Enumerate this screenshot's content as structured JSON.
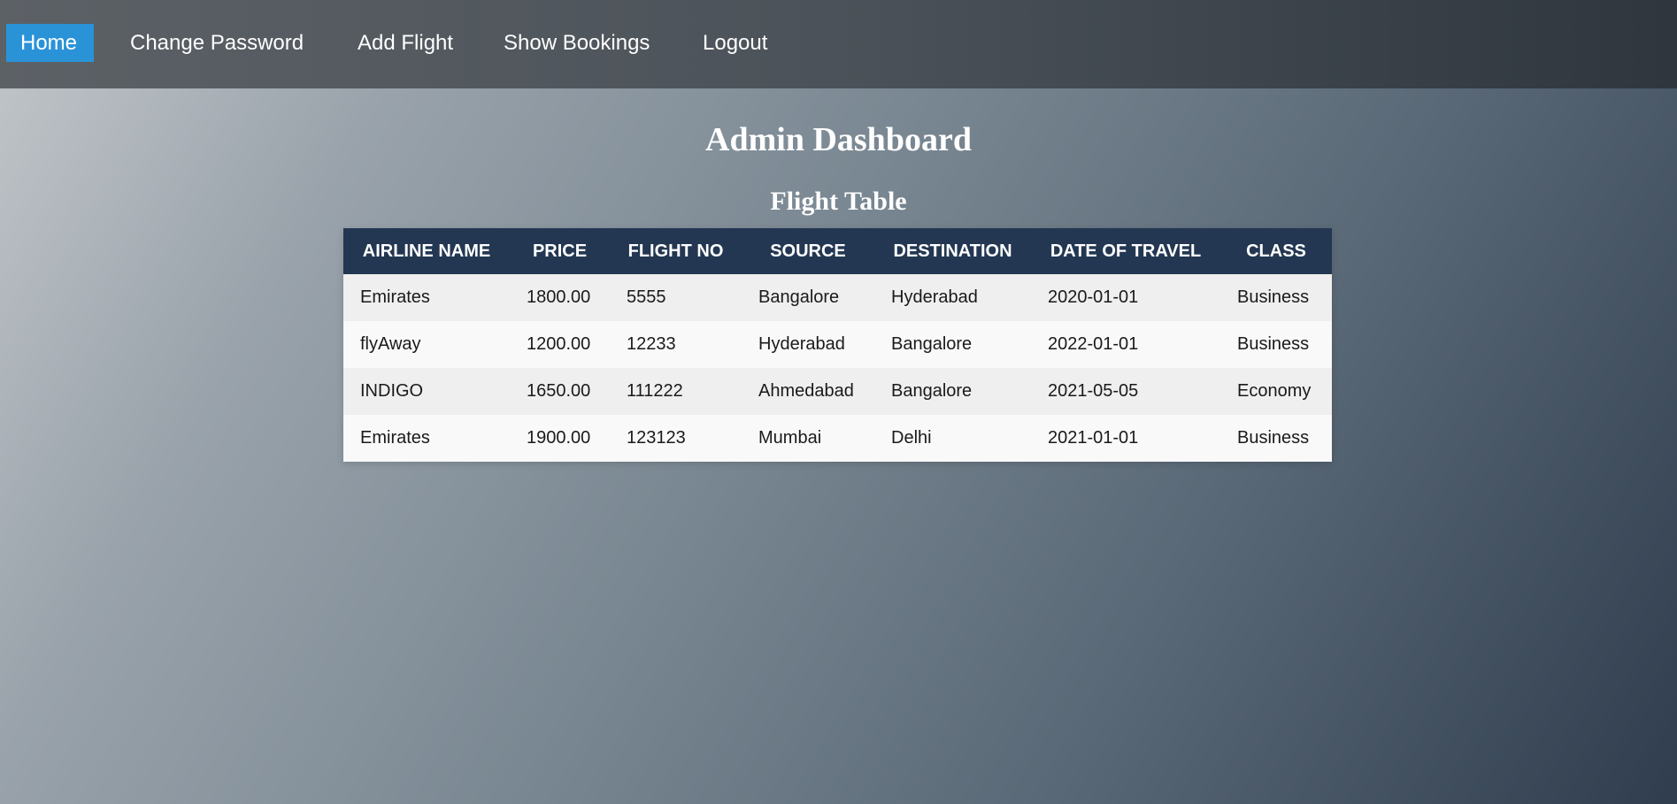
{
  "nav": {
    "home": "Home",
    "change_password": "Change Password",
    "add_flight": "Add Flight",
    "show_bookings": "Show Bookings",
    "logout": "Logout"
  },
  "page": {
    "title": "Admin Dashboard",
    "table_title": "Flight Table"
  },
  "table": {
    "headers": [
      "AIRLINE NAME",
      "PRICE",
      "FLIGHT NO",
      "SOURCE",
      "DESTINATION",
      "DATE OF TRAVEL",
      "CLASS"
    ],
    "rows": [
      [
        "Emirates",
        "1800.00",
        "5555",
        "Bangalore",
        "Hyderabad",
        "2020-01-01",
        "Business"
      ],
      [
        "flyAway",
        "1200.00",
        "12233",
        "Hyderabad",
        "Bangalore",
        "2022-01-01",
        "Business"
      ],
      [
        "INDIGO",
        "1650.00",
        "111222",
        "Ahmedabad",
        "Bangalore",
        "2021-05-05",
        "Economy"
      ],
      [
        "Emirates",
        "1900.00",
        "123123",
        "Mumbai",
        "Delhi",
        "2021-01-01",
        "Business"
      ]
    ]
  },
  "colors": {
    "navbar": "#4b5259",
    "active_nav": "#2a93d8",
    "table_header": "#233752",
    "row_odd": "#efefef",
    "row_even": "#f9f9f9"
  }
}
